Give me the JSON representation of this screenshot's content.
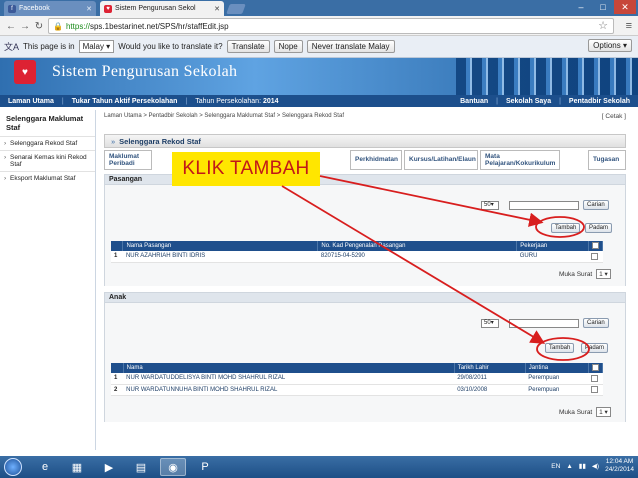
{
  "browser": {
    "tabs": [
      {
        "label": "Facebook",
        "icon": "facebook-icon"
      },
      {
        "label": "Sistem Pengurusan Sekol"
      }
    ],
    "url_scheme": "https://",
    "url_rest": "sps.1bestarinet.net/SPS/hr/staffEdit.jsp"
  },
  "translate_bar": {
    "prefix": "This page is in",
    "language": "Malay",
    "question": "Would you like to translate it?",
    "translate_label": "Translate",
    "nope_label": "Nope",
    "never_label": "Never translate Malay",
    "options_label": "Options"
  },
  "banner": {
    "title": "Sistem Pengurusan Sekolah"
  },
  "menubar": {
    "items": [
      "Laman Utama",
      "Tukar Tahun Aktif Persekolahan"
    ],
    "year_label": "Tahun Persekolahan:",
    "year_value": "2014",
    "right_items": [
      "Bantuan",
      "Sekolah Saya",
      "Pentadbir Sekolah"
    ]
  },
  "sidebar": {
    "heading": "Selenggara Maklumat Staf",
    "items": [
      "Selenggara Rekod Staf",
      "Senarai Kemas kini Rekod Staf",
      "Eksport Maklumat Staf"
    ]
  },
  "content": {
    "breadcrumb": "Laman Utama > Pentadbir Sekolah > Selenggara Maklumat Staf > Selenggara Rekod Staf",
    "cetak": "[ Cetak ]",
    "panel_title": "Selenggara Rekod Staf",
    "tabs": [
      "Maklumat Peribadi",
      "Perkhidmatan",
      "Kursus/Latihan/Elaun",
      "Mata Pelajaran/Kokurikulum",
      "Tugasan"
    ]
  },
  "pasangan": {
    "title": "Pasangan",
    "page_size": "50",
    "carian_label": "Carian",
    "tambah_label": "Tambah",
    "padam_label": "Padam",
    "columns": [
      "Nama Pasangan",
      "No. Kad Pengenalan Pasangan",
      "Pekerjaan"
    ],
    "rows": [
      {
        "no": "1",
        "name": "NUR AZAHRIAH BINTI IDRIS",
        "ic": "820715-04-5290",
        "job": "GURU"
      }
    ],
    "muka_label": "Muka Surat",
    "page_value": "1"
  },
  "anak": {
    "title": "Anak",
    "page_size": "50",
    "carian_label": "Carian",
    "tambah_label": "Tambah",
    "padam_label": "Padam",
    "columns": [
      "Nama",
      "Tarikh Lahir",
      "Jantina"
    ],
    "rows": [
      {
        "no": "1",
        "name": "NUR WARDATUDDELISYA BINTI MOHD SHAHRUL RIZAL",
        "dob": "29/08/2011",
        "gender": "Perempuan"
      },
      {
        "no": "2",
        "name": "NUR WARDATUNNUHA BINTI MOHD SHAHRUL RIZAL",
        "dob": "03/10/2008",
        "gender": "Perempuan"
      }
    ],
    "muka_label": "Muka Surat",
    "page_value": "1"
  },
  "annotation": {
    "text": "KLIK TAMBAH",
    "color": "#d81e1e",
    "bg": "#ffe600"
  },
  "taskbar": {
    "lang": "EN",
    "time": "12:04 AM",
    "date": "24/2/2014"
  }
}
